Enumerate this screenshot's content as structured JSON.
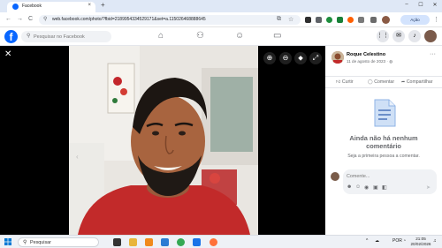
{
  "browser": {
    "tab_title": "Facebook",
    "tab_close": "×",
    "new_tab": "+",
    "window_min": "–",
    "window_max": "☐",
    "window_close": "✕",
    "back": "←",
    "forward": "→",
    "reload": "C",
    "url": "web.facebook.com/photo/?fbid=2189954334529171&set=a.115026468888645",
    "action_button": "Ação necessária",
    "menu": "⋮"
  },
  "facebook": {
    "logo": "f",
    "search_placeholder": "Pesquisar no Facebook",
    "nav_icons": [
      "home-icon",
      "friends-icon",
      "groups-icon",
      "gaming-icon"
    ],
    "colors": {
      "brand": "#0866ff",
      "viewer_bg": "#000000"
    }
  },
  "viewer": {
    "close": "✕",
    "toolbar": [
      "zoom-in-icon",
      "zoom-out-icon",
      "tag-icon",
      "fullscreen-icon"
    ],
    "prev_arrow": "‹"
  },
  "post": {
    "author": "Roque Celestino",
    "date": "11 de agosto de 2023 · ",
    "more": "···",
    "actions": {
      "like": "Curtir",
      "comment": "Comentar",
      "share": "Compartilhar"
    },
    "empty_title_line1": "Ainda não há nenhum",
    "empty_title_line2": "comentário",
    "empty_subtitle": "Seja a primeira pessoa a comentar.",
    "comment_placeholder": "Comente..."
  },
  "taskbar": {
    "search_label": "Pesquisar",
    "language": "POR",
    "time": "21:05",
    "date": "20/02/2026",
    "chevron": "^"
  }
}
